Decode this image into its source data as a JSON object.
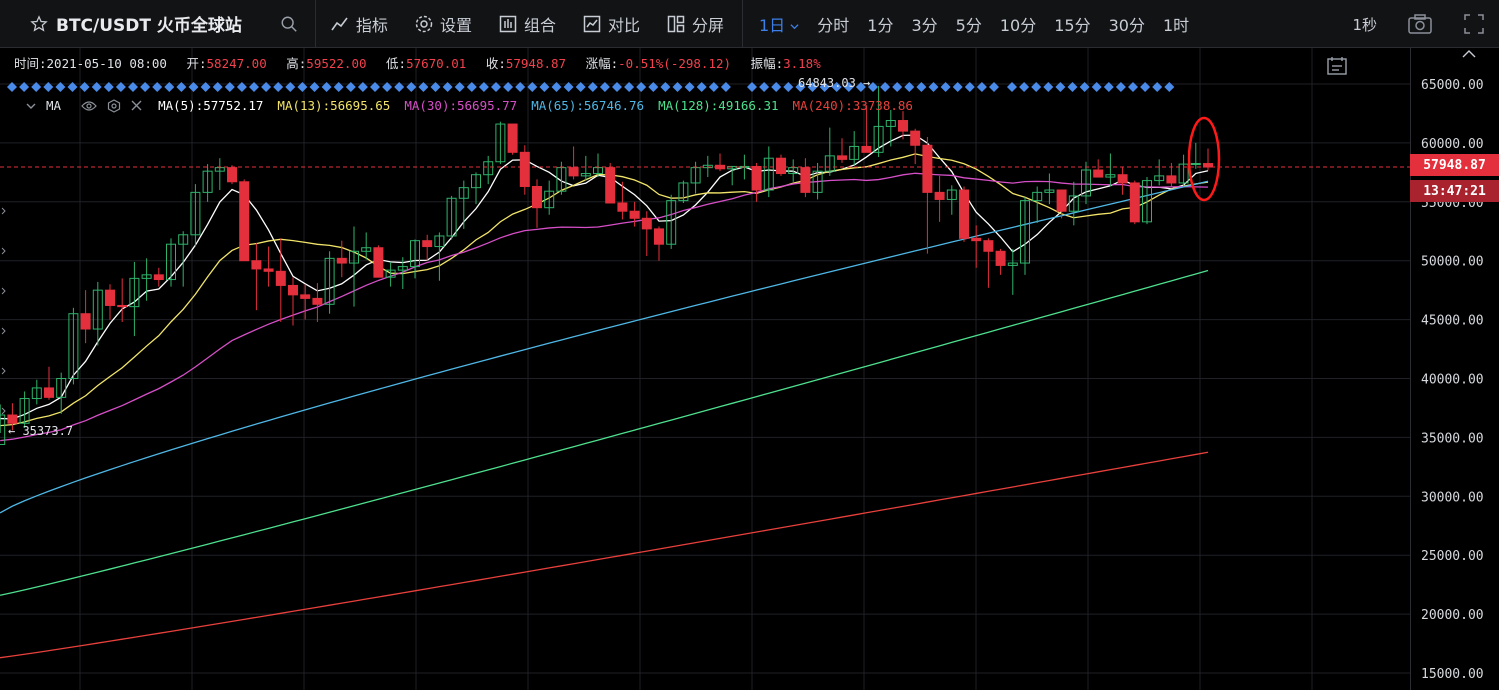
{
  "toolbar": {
    "symbol": "BTC/USDT 火币全球站",
    "buttons": {
      "indicator": "指标",
      "settings": "设置",
      "combo": "组合",
      "compare": "对比",
      "split": "分屏"
    },
    "periods": [
      {
        "label": "1日",
        "active": true
      },
      {
        "label": "分时"
      },
      {
        "label": "1分"
      },
      {
        "label": "3分"
      },
      {
        "label": "5分"
      },
      {
        "label": "10分"
      },
      {
        "label": "15分"
      },
      {
        "label": "30分"
      },
      {
        "label": "1时"
      }
    ],
    "refresh": "1秒"
  },
  "info": {
    "time_label": "时间:",
    "time": "2021-05-10 08:00",
    "open_label": "开:",
    "open": "58247.00",
    "high_label": "高:",
    "high": "59522.00",
    "low_label": "低:",
    "low": "57670.01",
    "close_label": "收:",
    "close": "57948.87",
    "change_label": "涨幅:",
    "change": "-0.51%(-298.12)",
    "amp_label": "振幅:",
    "amp": "3.18%"
  },
  "ma_legend": {
    "name": "MA",
    "items": [
      {
        "label": "MA(5):57752.17",
        "color": "#ffffff"
      },
      {
        "label": "MA(13):56695.65",
        "color": "#f2e46a"
      },
      {
        "label": "MA(30):56695.77",
        "color": "#d64fc8"
      },
      {
        "label": "MA(65):56746.76",
        "color": "#4fb7e6"
      },
      {
        "label": "MA(128):49166.31",
        "color": "#4ee08e"
      },
      {
        "label": "MA(240):33738.86",
        "color": "#e8403c"
      }
    ]
  },
  "price_tags": {
    "last": "57948.87",
    "countdown": "13:47:21"
  },
  "hi_label": "64843.03 →",
  "lo_label": "← 35373.7",
  "colors": {
    "up": "#2fb36b",
    "down": "#e3303c",
    "grid": "#1f2126",
    "axis_text": "#d6d9de"
  },
  "chart_data": {
    "type": "candlestick",
    "title": "BTC/USDT 火币全球站",
    "interval": "1日",
    "y_ticks": [
      15000,
      20000,
      25000,
      30000,
      35000,
      40000,
      45000,
      50000,
      55000,
      60000,
      65000
    ],
    "y_range": [
      14500,
      67000
    ],
    "last_price": 57948.87,
    "max_marker": 64843.03,
    "min_marker": 35373.7,
    "candles": [
      [
        34400,
        35373.7,
        37800,
        36900
      ],
      [
        36900,
        35600,
        37900,
        36200
      ],
      [
        36200,
        35800,
        38900,
        38300
      ],
      [
        38300,
        37800,
        39900,
        39200
      ],
      [
        39200,
        38200,
        41000,
        38400
      ],
      [
        38400,
        37000,
        40500,
        40000
      ],
      [
        40000,
        39500,
        46000,
        45500
      ],
      [
        45500,
        43000,
        47500,
        44200
      ],
      [
        44200,
        42800,
        48200,
        47500
      ],
      [
        47500,
        45000,
        48000,
        46200
      ],
      [
        46200,
        44800,
        48500,
        46100
      ],
      [
        46100,
        43600,
        49900,
        48500
      ],
      [
        48500,
        46600,
        50200,
        48800
      ],
      [
        48800,
        47800,
        49400,
        48400
      ],
      [
        48400,
        47800,
        51900,
        51400
      ],
      [
        51400,
        47800,
        52500,
        52200
      ],
      [
        52200,
        51200,
        56500,
        55800
      ],
      [
        55800,
        55000,
        58200,
        57600
      ],
      [
        57600,
        56000,
        58700,
        57900
      ],
      [
        57900,
        56500,
        58100,
        56700
      ],
      [
        56700,
        50800,
        56900,
        50000
      ],
      [
        50000,
        45800,
        51500,
        49300
      ],
      [
        49300,
        47800,
        51200,
        49100
      ],
      [
        49100,
        44800,
        51900,
        47900
      ],
      [
        47900,
        44500,
        48600,
        47100
      ],
      [
        47100,
        45000,
        48000,
        46800
      ],
      [
        46800,
        44800,
        48100,
        46300
      ],
      [
        46300,
        45500,
        50800,
        50200
      ],
      [
        50200,
        48600,
        51700,
        49800
      ],
      [
        49800,
        46100,
        52900,
        50800
      ],
      [
        50800,
        50100,
        52400,
        51100
      ],
      [
        51100,
        48800,
        51300,
        48600
      ],
      [
        48600,
        47800,
        49900,
        49200
      ],
      [
        49200,
        47600,
        50300,
        49500
      ],
      [
        49500,
        48500,
        51800,
        51700
      ],
      [
        51700,
        50000,
        52200,
        51200
      ],
      [
        51200,
        48300,
        52400,
        52100
      ],
      [
        52100,
        51800,
        55500,
        55300
      ],
      [
        55300,
        52700,
        56800,
        56200
      ],
      [
        56200,
        54800,
        57500,
        57300
      ],
      [
        57300,
        56500,
        58900,
        58400
      ],
      [
        58400,
        58200,
        61800,
        61600
      ],
      [
        61600,
        59000,
        61300,
        59200
      ],
      [
        59200,
        55600,
        59800,
        56300
      ],
      [
        56300,
        52800,
        56900,
        54500
      ],
      [
        54500,
        53900,
        56800,
        55900
      ],
      [
        55900,
        55600,
        58400,
        57900
      ],
      [
        57900,
        56900,
        59700,
        57200
      ],
      [
        57200,
        56800,
        58900,
        57400
      ],
      [
        57400,
        57100,
        59100,
        57900
      ],
      [
        57900,
        56900,
        58300,
        54900
      ],
      [
        54900,
        53500,
        56700,
        54200
      ],
      [
        54200,
        52900,
        55000,
        53600
      ],
      [
        53600,
        50400,
        54200,
        52700
      ],
      [
        52700,
        50000,
        52900,
        51400
      ],
      [
        51400,
        51000,
        55600,
        55100
      ],
      [
        55100,
        54900,
        56800,
        56600
      ],
      [
        56600,
        55700,
        58400,
        57900
      ],
      [
        57900,
        57100,
        58900,
        58100
      ],
      [
        58100,
        57600,
        59100,
        57800
      ],
      [
        57800,
        56400,
        58000,
        58000
      ],
      [
        58000,
        56900,
        59000,
        58000
      ],
      [
        58000,
        55000,
        58300,
        56000
      ],
      [
        56000,
        55400,
        59700,
        58700
      ],
      [
        58700,
        57200,
        59000,
        57400
      ],
      [
        57400,
        56700,
        58600,
        57900
      ],
      [
        57900,
        55400,
        58700,
        55800
      ],
      [
        55800,
        55200,
        58300,
        57600
      ],
      [
        57600,
        57200,
        61300,
        58900
      ],
      [
        58900,
        58300,
        60400,
        58600
      ],
      [
        58600,
        58100,
        61000,
        59700
      ],
      [
        59700,
        59300,
        63200,
        59200
      ],
      [
        59200,
        58800,
        64843.03,
        61400
      ],
      [
        61400,
        59700,
        62800,
        61900
      ],
      [
        61900,
        60300,
        62700,
        61000
      ],
      [
        61000,
        58200,
        61200,
        59800
      ],
      [
        59800,
        50600,
        60500,
        55800
      ],
      [
        55800,
        53300,
        57200,
        55200
      ],
      [
        55200,
        53900,
        56400,
        56000
      ],
      [
        56000,
        51600,
        56300,
        51900
      ],
      [
        51900,
        49400,
        53000,
        51700
      ],
      [
        51700,
        47700,
        51900,
        50800
      ],
      [
        50800,
        48800,
        51000,
        49600
      ],
      [
        49600,
        47100,
        51000,
        49800
      ],
      [
        49800,
        48800,
        55400,
        55100
      ],
      [
        55100,
        53200,
        56300,
        55800
      ],
      [
        55800,
        54800,
        57400,
        56000
      ],
      [
        56000,
        53600,
        55900,
        54200
      ],
      [
        54200,
        53000,
        56700,
        55500
      ],
      [
        55500,
        54800,
        58400,
        57700
      ],
      [
        57700,
        57100,
        58600,
        57100
      ],
      [
        57100,
        56300,
        59100,
        57300
      ],
      [
        57300,
        55600,
        58000,
        56600
      ],
      [
        56600,
        53100,
        56800,
        53300
      ],
      [
        53300,
        53100,
        57100,
        56800
      ],
      [
        56800,
        56400,
        58600,
        57200
      ],
      [
        57200,
        56300,
        58300,
        56600
      ],
      [
        56600,
        56300,
        59000,
        58200
      ],
      [
        58200,
        57800,
        60000,
        58250
      ],
      [
        58247,
        57670.01,
        59522,
        57948.87
      ]
    ],
    "ma": [
      {
        "name": "MA(5)",
        "color": "#ffffff",
        "values": []
      },
      {
        "name": "MA(13)",
        "color": "#f2e46a",
        "values": []
      },
      {
        "name": "MA(30)",
        "color": "#d64fc8",
        "values": []
      },
      {
        "name": "MA(65)",
        "color": "#4fb7e6",
        "values": []
      },
      {
        "name": "MA(128)",
        "color": "#4ee08e",
        "values": []
      },
      {
        "name": "MA(240)",
        "color": "#e8403c",
        "values": []
      }
    ]
  }
}
